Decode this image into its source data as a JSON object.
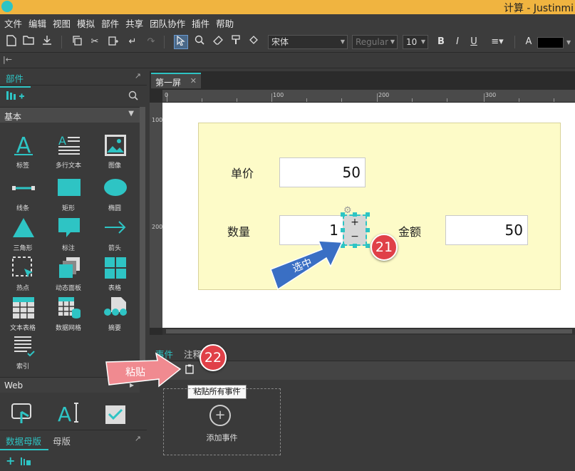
{
  "window": {
    "title": "计算 - Justinmi"
  },
  "menu": [
    "文件",
    "编辑",
    "视图",
    "模拟",
    "部件",
    "共享",
    "团队协作",
    "插件",
    "帮助"
  ],
  "toolbar": {
    "font_name": "宋体",
    "font_style": "Regular",
    "font_size": "10",
    "bold": "B",
    "italic": "I",
    "underline": "U"
  },
  "left_panel": {
    "tab": "部件",
    "category_basic": "基本",
    "category_web": "Web",
    "widgets": [
      {
        "label": "标签",
        "icon": "text-label-icon"
      },
      {
        "label": "多行文本",
        "icon": "multiline-text-icon"
      },
      {
        "label": "图像",
        "icon": "image-icon"
      },
      {
        "label": "线条",
        "icon": "line-icon"
      },
      {
        "label": "矩形",
        "icon": "rectangle-icon"
      },
      {
        "label": "椭圆",
        "icon": "ellipse-icon"
      },
      {
        "label": "三角形",
        "icon": "triangle-icon"
      },
      {
        "label": "标注",
        "icon": "callout-icon"
      },
      {
        "label": "箭头",
        "icon": "arrow-icon"
      },
      {
        "label": "热点",
        "icon": "hotspot-icon"
      },
      {
        "label": "动态面板",
        "icon": "dynamic-panel-icon"
      },
      {
        "label": "表格",
        "icon": "table-icon"
      },
      {
        "label": "文本表格",
        "icon": "text-grid-icon"
      },
      {
        "label": "数据网格",
        "icon": "data-grid-icon"
      },
      {
        "label": "摘要",
        "icon": "summary-icon"
      },
      {
        "label": "索引",
        "icon": "index-icon"
      }
    ],
    "bottom_tabs": [
      "数据母版",
      "母版"
    ]
  },
  "document": {
    "tab": "第一屏",
    "ruler_h": [
      "0",
      "100",
      "200",
      "300"
    ],
    "ruler_v": [
      "100",
      "200"
    ],
    "form": {
      "unit_price_label": "单价",
      "unit_price_value": "50",
      "quantity_label": "数量",
      "quantity_value": "1",
      "amount_label": "金额",
      "amount_value": "50",
      "stepper_plus": "+",
      "stepper_minus": "−"
    }
  },
  "bottom_panel": {
    "tabs": [
      "事件",
      "注释"
    ],
    "tooltip": "粘贴所有事件",
    "add_event": "添加事件"
  },
  "annotations": {
    "select_label": "选中",
    "paste_label": "粘贴",
    "badge_21": "21",
    "badge_22": "22"
  },
  "colors": {
    "accent": "#2ec4c4",
    "badge": "#e04048",
    "select_arrow": "#3a6fc4",
    "paste_arrow": "#f08a90",
    "title_bar": "#f0b440",
    "form_bg": "#fdfbc8"
  }
}
